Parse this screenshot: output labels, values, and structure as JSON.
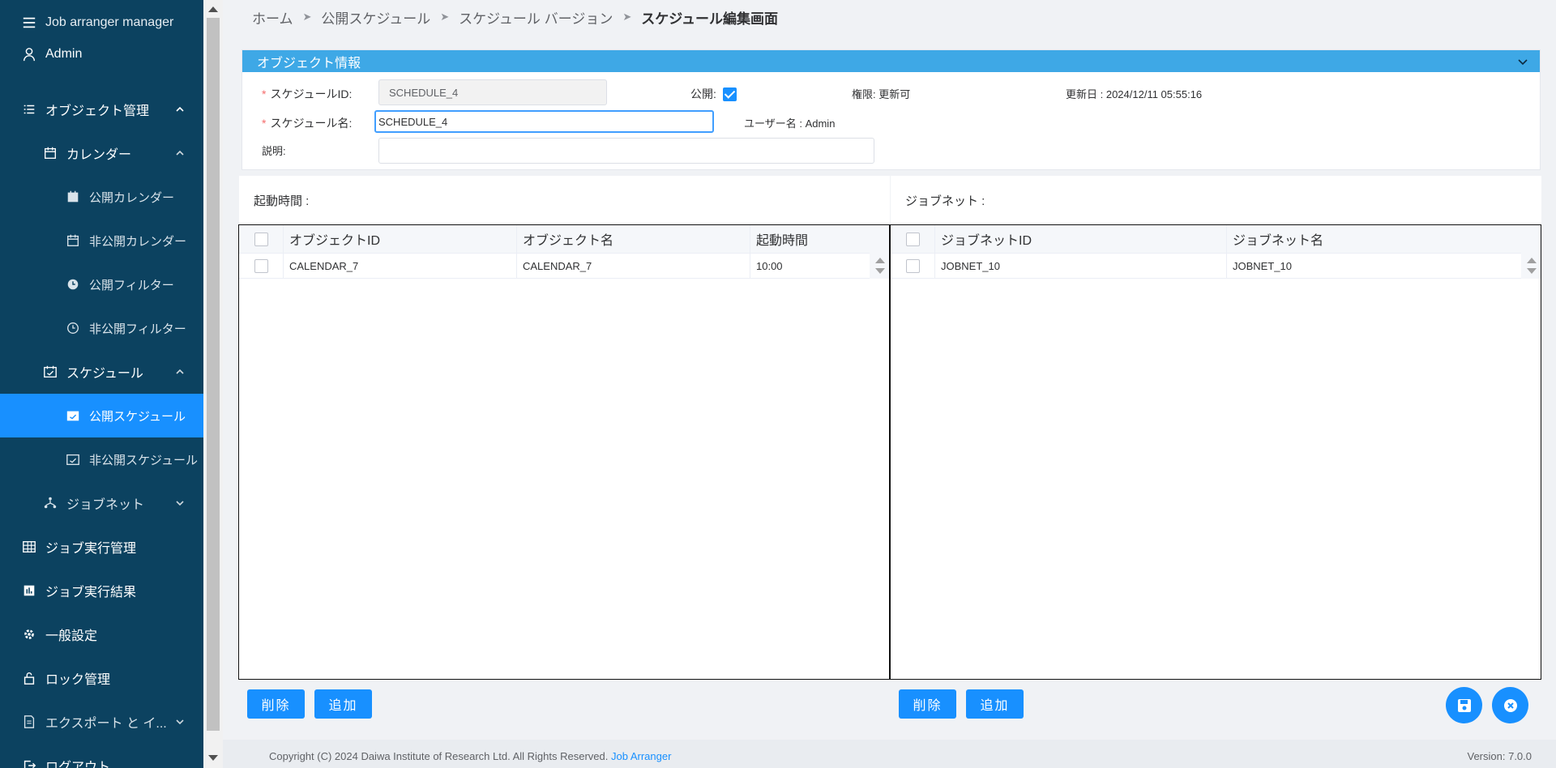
{
  "app": {
    "title": "Job arranger manager"
  },
  "sidebar": {
    "user": "Admin",
    "items": [
      {
        "label": "オブジェクト管理"
      },
      {
        "label": "カレンダー"
      },
      {
        "label": "公開カレンダー"
      },
      {
        "label": "非公開カレンダー"
      },
      {
        "label": "公開フィルター"
      },
      {
        "label": "非公開フィルター"
      },
      {
        "label": "スケジュール"
      },
      {
        "label": "公開スケジュール"
      },
      {
        "label": "非公開スケジュール"
      },
      {
        "label": "ジョブネット"
      },
      {
        "label": "ジョブ実行管理"
      },
      {
        "label": "ジョブ実行結果"
      },
      {
        "label": "一般設定"
      },
      {
        "label": "ロック管理"
      },
      {
        "label": "エクスポート と イ..."
      },
      {
        "label": "ログアウト"
      }
    ]
  },
  "breadcrumb": {
    "sep": "➤",
    "items": [
      "ホーム",
      "公開スケジュール",
      "スケジュール バージョン",
      "スケジュール編集画面"
    ]
  },
  "object_info": {
    "title": "オブジェクト情報",
    "id_label": "スケジュールID:",
    "id_value": "SCHEDULE_4",
    "public_label": "公開:",
    "public_checked": true,
    "permission": "権限: 更新可",
    "updated": "更新日 : 2024/12/11 05:55:16",
    "name_label": "スケジュール名:",
    "name_value": "SCHEDULE_4",
    "user": "ユーザー名 : Admin",
    "desc_label": "説明:",
    "desc_value": "",
    "required_mark": "*"
  },
  "boot_time": {
    "title": "起動時間 :",
    "columns": [
      "オブジェクトID",
      "オブジェクト名",
      "起動時間"
    ],
    "rows": [
      {
        "id": "CALENDAR_7",
        "name": "CALENDAR_7",
        "time": "10:00"
      }
    ],
    "delete_label": "削除",
    "add_label": "追加"
  },
  "jobnet": {
    "title": "ジョブネット :",
    "columns": [
      "ジョブネットID",
      "ジョブネット名"
    ],
    "rows": [
      {
        "id": "JOBNET_10",
        "name": "JOBNET_10"
      }
    ],
    "delete_label": "削除",
    "add_label": "追加"
  },
  "footer": {
    "copyright": "Copyright (C) 2024 Daiwa Institute of Research Ltd. All Rights Reserved.",
    "link": "Job Arranger",
    "version": "Version: 7.0.0"
  },
  "colors": {
    "sidebar": "#0c4260",
    "accent": "#1890ff",
    "panel_header": "#3ea8e6"
  }
}
